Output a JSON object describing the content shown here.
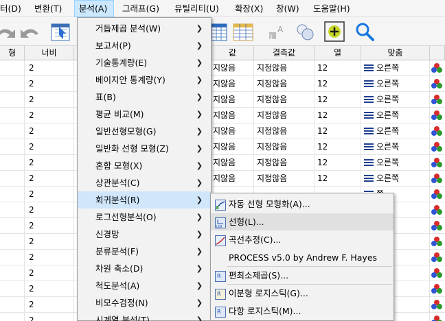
{
  "menubar": {
    "items": [
      "터(D)",
      "변환(T)",
      "분석(A)",
      "그래프(G)",
      "유틸리티(U)",
      "확장(X)",
      "창(W)",
      "도움말(H)"
    ],
    "active_index": 2
  },
  "grid": {
    "headers": [
      "형",
      "너비",
      "값",
      "결측값",
      "열",
      "맞춤"
    ],
    "rows": [
      {
        "width": "2",
        "value": "지않음",
        "missing": "지정않음",
        "columns": "12",
        "align": "오른쪽"
      },
      {
        "width": "2",
        "value": "지않음",
        "missing": "지정않음",
        "columns": "12",
        "align": "오른쪽"
      },
      {
        "width": "2",
        "value": "지않음",
        "missing": "지정않음",
        "columns": "12",
        "align": "오른쪽"
      },
      {
        "width": "2",
        "value": "지않음",
        "missing": "지정않음",
        "columns": "12",
        "align": "오른쪽"
      },
      {
        "width": "2",
        "value": "지않음",
        "missing": "지정않음",
        "columns": "12",
        "align": "오른쪽"
      },
      {
        "width": "2",
        "value": "지않음",
        "missing": "지정않음",
        "columns": "12",
        "align": "오른쪽"
      },
      {
        "width": "2",
        "value": "지않음",
        "missing": "지정않음",
        "columns": "12",
        "align": "오른쪽"
      },
      {
        "width": "2",
        "value": "지않음",
        "missing": "지정않음",
        "columns": "12",
        "align": "오른쪽"
      },
      {
        "width": "2",
        "value": "",
        "missing": "",
        "columns": "",
        "align": "쪽"
      },
      {
        "width": "2",
        "value": "",
        "missing": "",
        "columns": "",
        "align": "쪽"
      },
      {
        "width": "2",
        "value": "",
        "missing": "",
        "columns": "",
        "align": "쪽"
      },
      {
        "width": "2",
        "value": "",
        "missing": "",
        "columns": "",
        "align": "쪽"
      },
      {
        "width": "2",
        "value": "",
        "missing": "",
        "columns": "",
        "align": "쪽"
      },
      {
        "width": "2",
        "value": "",
        "missing": "",
        "columns": "",
        "align": "쪽"
      },
      {
        "width": "2",
        "value": "",
        "missing": "",
        "columns": "",
        "align": "쪽"
      },
      {
        "width": "2",
        "value": "",
        "missing": "",
        "columns": "",
        "align": "쪽"
      },
      {
        "width": "2",
        "value": "",
        "missing": "",
        "columns": "",
        "align": "쪽"
      }
    ]
  },
  "analyze_menu": {
    "items": [
      {
        "label": "거듭제곱 분석(W)",
        "submenu": true
      },
      {
        "label": "보고서(P)",
        "submenu": true
      },
      {
        "label": "기술통계량(E)",
        "submenu": true
      },
      {
        "label": "베이지안 통계량(Y)",
        "submenu": true
      },
      {
        "label": "표(B)",
        "submenu": true
      },
      {
        "label": "평균 비교(M)",
        "submenu": true
      },
      {
        "label": "일반선형모형(G)",
        "submenu": true
      },
      {
        "label": "일반화 선형 모형(Z)",
        "submenu": true
      },
      {
        "label": "혼합 모형(X)",
        "submenu": true
      },
      {
        "label": "상관분석(C)",
        "submenu": true
      },
      {
        "label": "회귀분석(R)",
        "submenu": true
      },
      {
        "label": "로그선형분석(O)",
        "submenu": true
      },
      {
        "label": "신경망",
        "submenu": true
      },
      {
        "label": "분류분석(F)",
        "submenu": true
      },
      {
        "label": "차원 축소(D)",
        "submenu": true
      },
      {
        "label": "척도분석(A)",
        "submenu": true
      },
      {
        "label": "비모수검정(N)",
        "submenu": true
      },
      {
        "label": "시계열 분석(T)",
        "submenu": true
      }
    ],
    "highlighted_index": 10
  },
  "regression_menu": {
    "items": [
      {
        "label": "자동 선형 모형화(A)...",
        "icon": "auto-linear-icon"
      },
      {
        "label": "선형(L)...",
        "icon": "linear-icon"
      },
      {
        "label": "곡선추정(C)...",
        "icon": "curve-estimation-icon"
      },
      {
        "label": "PROCESS v5.0 by Andrew F. Hayes",
        "icon": ""
      },
      {
        "label": "편최소제곱(S)...",
        "icon": "partial-least-squares-icon"
      },
      {
        "label": "이분형 로지스틱(G)...",
        "icon": "binary-logistic-icon"
      },
      {
        "label": "다항 로지스틱(M)...",
        "icon": "multinomial-logistic-icon"
      }
    ],
    "highlighted_index": 1
  },
  "colors": {
    "accent": "#0078d7",
    "menu_highlight": "#cfe6fb",
    "measure_red": "#d92b2b",
    "measure_blue": "#2f55d4",
    "measure_green": "#2a9a2a"
  }
}
